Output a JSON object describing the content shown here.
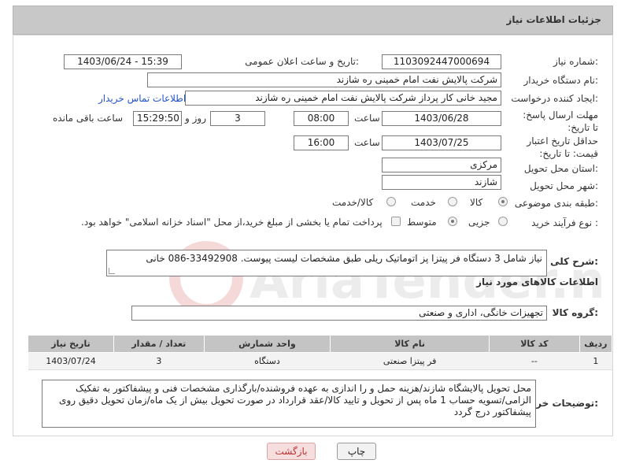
{
  "page": {
    "title": "جزئیات اطلاعات نیاز"
  },
  "fields": {
    "need_number": {
      "label": "شماره نیاز:",
      "value": "1103092447000694"
    },
    "announce_datetime": {
      "label": "تاریخ و ساعت اعلان عمومی:",
      "value": "1403/06/24 - 15:39"
    },
    "buyer_org": {
      "label": "نام دستگاه خریدار:",
      "value": "شرکت پالایش نفت امام خمینی  ره  شازند"
    },
    "requester": {
      "label": "ایجاد کننده درخواست:",
      "value": "مجید خانی کار پرداز شرکت پالایش نفت امام خمینی  ره  شازند",
      "contact_link": "اطلاعات تماس خریدار"
    },
    "reply_deadline": {
      "label": "مهلت ارسال پاسخ: تا تاریخ:",
      "date": "1403/06/28",
      "time_label": "ساعت",
      "time": "08:00",
      "days": "3",
      "days_label": "روز و",
      "remaining": "15:29:50",
      "remaining_label": "ساعت باقی مانده"
    },
    "price_validity": {
      "label": "حداقل تاریخ اعتبار قیمت: تا تاریخ:",
      "date": "1403/07/25",
      "time_label": "ساعت",
      "time": "16:00"
    },
    "delivery_province": {
      "label": "استان محل تحویل:",
      "value": "مرکزی"
    },
    "delivery_city": {
      "label": "شهر محل تحویل:",
      "value": "شازند"
    },
    "category": {
      "label": "طبقه بندی موضوعی:",
      "options": [
        "کالا",
        "خدمت",
        "کالا/خدمت"
      ]
    },
    "purchase_process": {
      "label": "نوع فرآیند خرید :",
      "options": [
        "جزیی",
        "متوسط"
      ],
      "checkbox_text": "پرداخت تمام یا بخشی از مبلغ خرید،از محل \"اسناد خزانه اسلامی\" خواهد بود."
    },
    "general_description": {
      "label": "شرح کلی نیاز:",
      "value": "نیاز شامل 3 دستگاه فر پیتزا پز اتوماتیک ریلی طبق مشخصات لیست پیوست. 33492908-086 خانی"
    }
  },
  "goods": {
    "section_title": "اطلاعات کالاهای مورد نیاز",
    "group_label": "گروه کالا:",
    "group_value": "تجهیزات خانگی، اداری و صنعتی",
    "columns": [
      "ردیف",
      "کد کالا",
      "نام کالا",
      "واحد شمارش",
      "تعداد / مقدار",
      "تاریخ نیاز"
    ],
    "rows": [
      [
        "1",
        "--",
        "فر پیتزا صنعتی",
        "دستگاه",
        "3",
        "1403/07/24"
      ]
    ]
  },
  "buyer_notes": {
    "label": "توضیحات خریدار:",
    "value": "محل تحویل پالایشگاه شازند/هزینه حمل و را اندازی به عهده فروشنده/بارگذاری مشخصات فنی و پیشفاکتور به تفکیک الزامی/تسویه حساب 1 ماه پس از تحویل و تایید کالا/عقد قرارداد در صورت تحویل بیش از یک ماه/زمان تحویل دقیق روی پیشفاکتور درج گردد"
  },
  "buttons": {
    "print": "چاپ",
    "back": "بازگشت"
  },
  "watermark": {
    "text": "AriaTender.neT"
  }
}
